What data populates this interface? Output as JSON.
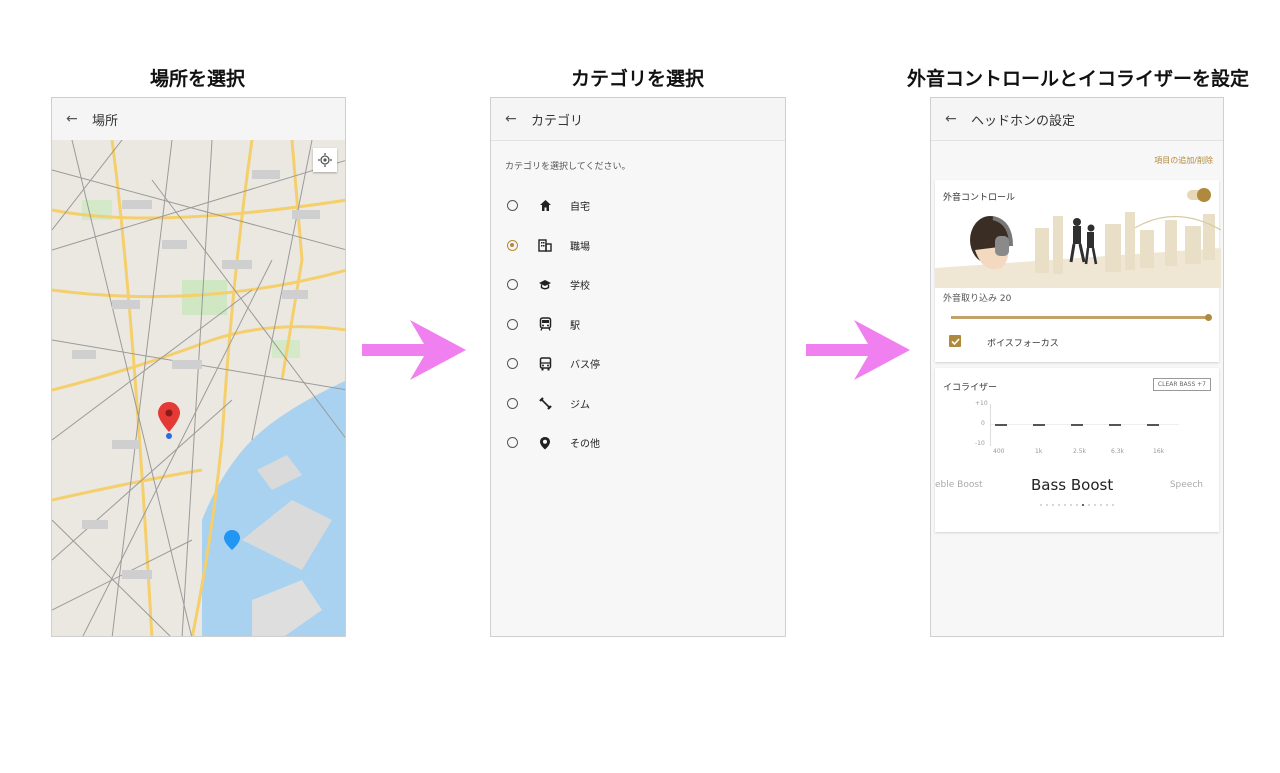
{
  "steps": [
    {
      "title": "場所を選択"
    },
    {
      "title": "カテゴリを選択"
    },
    {
      "title": "外音コントロールとイコライザーを設定"
    }
  ],
  "location_screen": {
    "appbar_title": "場所"
  },
  "category_screen": {
    "appbar_title": "カテゴリ",
    "hint": "カテゴリを選択してください。",
    "items": [
      {
        "label": "自宅",
        "icon": "home-icon",
        "selected": false
      },
      {
        "label": "職場",
        "icon": "office-building-icon",
        "selected": true
      },
      {
        "label": "学校",
        "icon": "school-cap-icon",
        "selected": false
      },
      {
        "label": "駅",
        "icon": "train-icon",
        "selected": false
      },
      {
        "label": "バス停",
        "icon": "bus-icon",
        "selected": false
      },
      {
        "label": "ジム",
        "icon": "dumbbell-icon",
        "selected": false
      },
      {
        "label": "その他",
        "icon": "place-pin-icon",
        "selected": false
      }
    ]
  },
  "settings_screen": {
    "appbar_title": "ヘッドホンの設定",
    "add_remove_link": "項目の追加/削除",
    "ambient": {
      "title": "外音コントロール",
      "toggle_on": true,
      "level_label": "外音取り込み 20",
      "level_fraction": 1.0,
      "voice_focus_label": "ボイスフォーカス",
      "voice_focus_checked": true
    },
    "equalizer": {
      "title": "イコライザー",
      "clear_bass_label": "CLEAR BASS +7",
      "y_top": "+10",
      "y_mid": "0",
      "y_bottom": "-10",
      "bands": [
        "400",
        "1k",
        "2.5k",
        "6.3k",
        "16k"
      ],
      "band_values": [
        0,
        0,
        0,
        0,
        0
      ],
      "preset_prev": "eble Boost",
      "preset_current": "Bass Boost",
      "preset_next": "Speech",
      "page_count": 13,
      "page_active": 8
    }
  },
  "colors": {
    "accent": "#b08a3c",
    "flow_arrow": "#f07ff0",
    "map_water": "#a8d2f0",
    "pin_red": "#e53935"
  }
}
